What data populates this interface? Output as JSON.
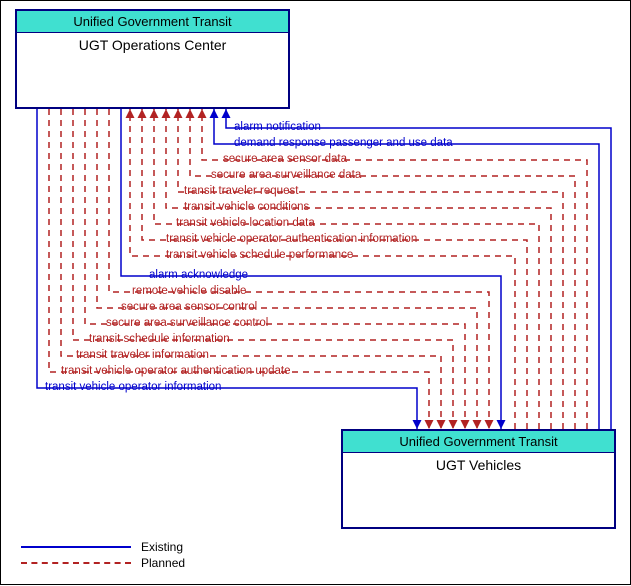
{
  "nodes": {
    "top": {
      "org": "Unified Government Transit",
      "name": "UGT Operations Center"
    },
    "bottom": {
      "org": "Unified Government Transit",
      "name": "UGT Vehicles"
    }
  },
  "flows_to_top": [
    {
      "label": "alarm notification",
      "style": "existing"
    },
    {
      "label": "demand response passenger and use data",
      "style": "existing"
    },
    {
      "label": "secure area sensor data",
      "style": "planned"
    },
    {
      "label": "secure area surveillance data",
      "style": "planned"
    },
    {
      "label": "transit traveler request",
      "style": "planned"
    },
    {
      "label": "transit vehicle conditions",
      "style": "planned"
    },
    {
      "label": "transit vehicle location data",
      "style": "planned"
    },
    {
      "label": "transit vehicle operator authentication information",
      "style": "planned"
    },
    {
      "label": "transit vehicle schedule performance",
      "style": "planned"
    }
  ],
  "flows_to_bottom": [
    {
      "label": "alarm acknowledge",
      "style": "existing"
    },
    {
      "label": "remote vehicle disable",
      "style": "planned"
    },
    {
      "label": "secure area sensor control",
      "style": "planned"
    },
    {
      "label": "secure area surveillance control",
      "style": "planned"
    },
    {
      "label": "transit schedule information",
      "style": "planned"
    },
    {
      "label": "transit traveler information",
      "style": "planned"
    },
    {
      "label": "transit vehicle operator authentication update",
      "style": "planned"
    },
    {
      "label": "transit vehicle operator information",
      "style": "existing"
    }
  ],
  "legend": {
    "existing": "Existing",
    "planned": "Planned"
  },
  "colors": {
    "existing": "#0000cc",
    "planned": "#b22222"
  }
}
